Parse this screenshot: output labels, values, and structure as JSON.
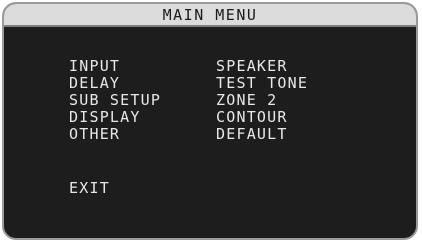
{
  "title": "MAIN MENU",
  "menu": {
    "left": [
      "INPUT",
      "DELAY",
      "SUB SETUP",
      "DISPLAY",
      "OTHER"
    ],
    "right": [
      "SPEAKER",
      "TEST TONE",
      "ZONE 2",
      "CONTOUR",
      "DEFAULT"
    ]
  },
  "exit_label": "EXIT",
  "colors": {
    "screen_background": "#1d1d1d",
    "title_bar_background": "#dcdcdc",
    "text": "#e8e8e8",
    "title_text": "#1a1a1a",
    "frame_border": "#9a9a9a"
  }
}
